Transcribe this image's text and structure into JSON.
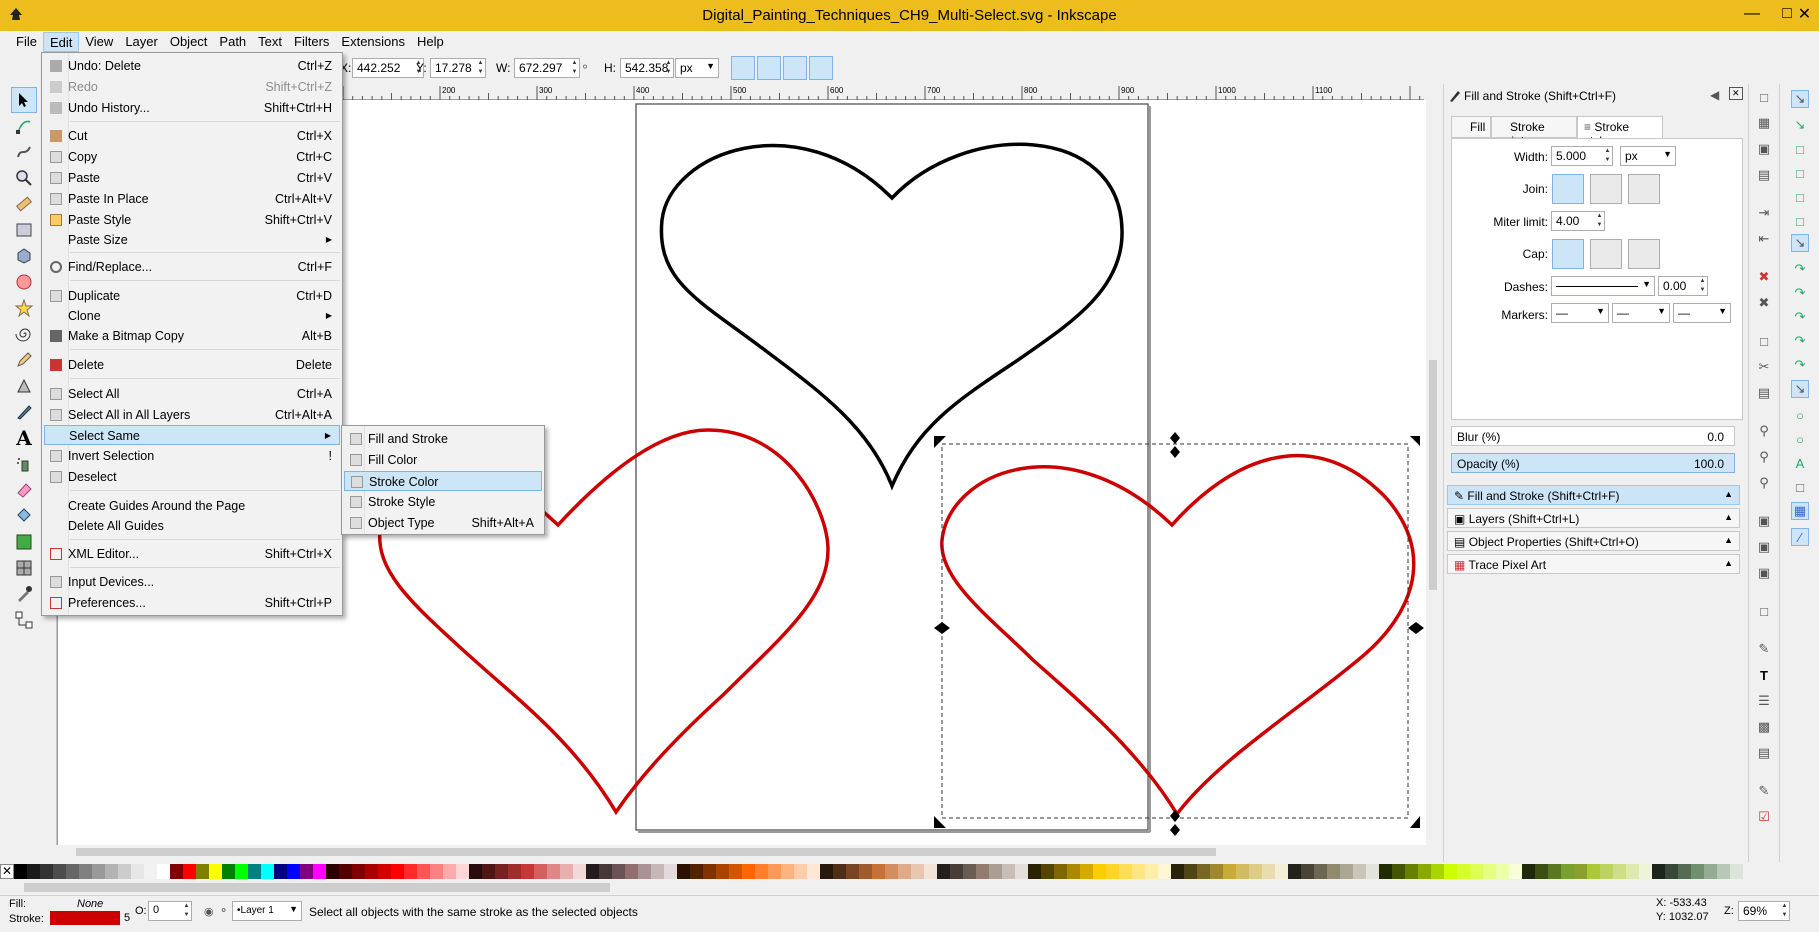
{
  "window": {
    "title": "Digital_Painting_Techniques_CH9_Multi-Select.svg - Inkscape"
  },
  "menubar": [
    "File",
    "Edit",
    "View",
    "Layer",
    "Object",
    "Path",
    "Text",
    "Filters",
    "Extensions",
    "Help"
  ],
  "toolbar": {
    "x_label": "X:",
    "x_value": "442.252",
    "y_label": "Y:",
    "y_value": "17.278",
    "w_label": "W:",
    "w_value": "672.297",
    "h_label": "H:",
    "h_value": "542.358",
    "unit": "px"
  },
  "edit_menu": {
    "undo": {
      "label": "Undo: Delete",
      "accel": "Ctrl+Z"
    },
    "redo": {
      "label": "Redo",
      "accel": "Shift+Ctrl+Z"
    },
    "undo_history": {
      "label": "Undo History...",
      "accel": "Shift+Ctrl+H"
    },
    "cut": {
      "label": "Cut",
      "accel": "Ctrl+X"
    },
    "copy": {
      "label": "Copy",
      "accel": "Ctrl+C"
    },
    "paste": {
      "label": "Paste",
      "accel": "Ctrl+V"
    },
    "paste_in_place": {
      "label": "Paste In Place",
      "accel": "Ctrl+Alt+V"
    },
    "paste_style": {
      "label": "Paste Style",
      "accel": "Shift+Ctrl+V"
    },
    "paste_size": {
      "label": "Paste Size"
    },
    "find_replace": {
      "label": "Find/Replace...",
      "accel": "Ctrl+F"
    },
    "duplicate": {
      "label": "Duplicate",
      "accel": "Ctrl+D"
    },
    "clone": {
      "label": "Clone"
    },
    "bitmap_copy": {
      "label": "Make a Bitmap Copy",
      "accel": "Alt+B"
    },
    "delete": {
      "label": "Delete",
      "accel": "Delete"
    },
    "select_all": {
      "label": "Select All",
      "accel": "Ctrl+A"
    },
    "select_all_layers": {
      "label": "Select All in All Layers",
      "accel": "Ctrl+Alt+A"
    },
    "select_same": {
      "label": "Select Same"
    },
    "invert_selection": {
      "label": "Invert Selection",
      "accel": "!"
    },
    "deselect": {
      "label": "Deselect"
    },
    "create_guides": {
      "label": "Create Guides Around the Page"
    },
    "delete_guides": {
      "label": "Delete All Guides"
    },
    "xml_editor": {
      "label": "XML Editor...",
      "accel": "Shift+Ctrl+X"
    },
    "input_devices": {
      "label": "Input Devices..."
    },
    "preferences": {
      "label": "Preferences...",
      "accel": "Shift+Ctrl+P"
    }
  },
  "select_same_menu": {
    "fill_and_stroke": {
      "label": "Fill and Stroke"
    },
    "fill_color": {
      "label": "Fill Color"
    },
    "stroke_color": {
      "label": "Stroke Color"
    },
    "stroke_style": {
      "label": "Stroke Style"
    },
    "object_type": {
      "label": "Object Type",
      "accel": "Shift+Alt+A"
    }
  },
  "dock": {
    "title": "Fill and Stroke (Shift+Ctrl+F)",
    "tabs": [
      "Fill",
      "Stroke paint",
      "Stroke style"
    ],
    "width_label": "Width:",
    "width_value": "5.000",
    "width_unit": "px",
    "join_label": "Join:",
    "miter_label": "Miter limit:",
    "miter_value": "4.00",
    "cap_label": "Cap:",
    "dashes_label": "Dashes:",
    "dashes_value": "0.00",
    "markers_label": "Markers:",
    "blur_label": "Blur (%)",
    "blur_value": "0.0",
    "opacity_label": "Opacity (%)",
    "opacity_value": "100.0",
    "panels": [
      "Fill and Stroke (Shift+Ctrl+F)",
      "Layers (Shift+Ctrl+L)",
      "Object Properties (Shift+Ctrl+O)",
      "Trace Pixel Art"
    ]
  },
  "statusbar": {
    "fill_label": "Fill:",
    "fill_value": "None",
    "stroke_label": "Stroke:",
    "stroke_width": "5",
    "opacity_label": "O:",
    "opacity_value": "0",
    "layer": "•Layer 1",
    "message": "Select all objects with the same stroke as the selected objects",
    "x_coord": "X: -533.43",
    "y_coord": "Y: 1032.07",
    "zoom_label": "Z:",
    "zoom_value": "69%"
  },
  "ruler_labels": [
    "200",
    "300",
    "400",
    "500",
    "600",
    "700",
    "800",
    "900",
    "1000",
    "1100"
  ],
  "colors": {
    "stroke_red": "#cc0000",
    "title_bar": "#ecbd1c",
    "highlight": "#cde6f7"
  }
}
